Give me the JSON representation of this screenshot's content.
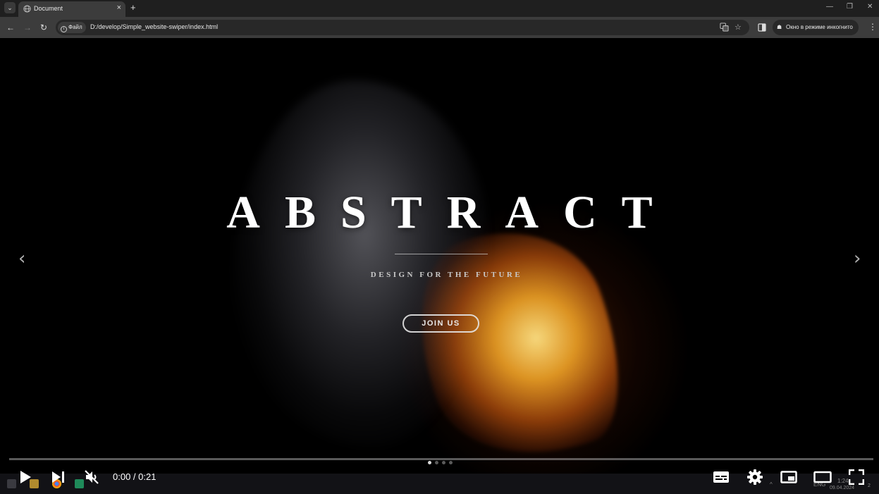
{
  "browser": {
    "tab_title": "Document",
    "new_tab": "+",
    "tab_close": "×",
    "tab_menu": "⌄",
    "window_controls": [
      "—",
      "❐",
      "✕"
    ],
    "nav": {
      "back": "←",
      "forward": "→",
      "reload": "↻"
    },
    "site_info_label": "Файл",
    "url": "D:/develop/Simple_website-swiper/index.html",
    "incognito_label": "Окно в режиме инкогнито",
    "menu": "⋮",
    "icons": [
      "translate-icon",
      "star-icon",
      "side-panel-icon"
    ]
  },
  "hero": {
    "title": "ABSTRACT",
    "subtitle": "DESIGN FOR THE FUTURE",
    "cta_label": "JOIN US",
    "prev_arrow": "‹",
    "next_arrow": "›",
    "pagination": {
      "total": 4,
      "active": 0
    },
    "colors": {
      "fire": "#f5a623",
      "smoke": "#8c8c96",
      "background": "#000000"
    }
  },
  "taskbar": {
    "tray": {
      "language": "ENG",
      "time": "1:24",
      "date": "09.04.2024",
      "notifications": "2"
    }
  },
  "player": {
    "time_display": "0:00 / 0:21",
    "progress": 0,
    "muted": true,
    "accent": "#ff0000",
    "controls": [
      "play-icon",
      "next-icon",
      "mute-icon",
      "subtitles-icon",
      "settings-icon",
      "miniplayer-icon",
      "theater-icon",
      "fullscreen-icon"
    ]
  }
}
